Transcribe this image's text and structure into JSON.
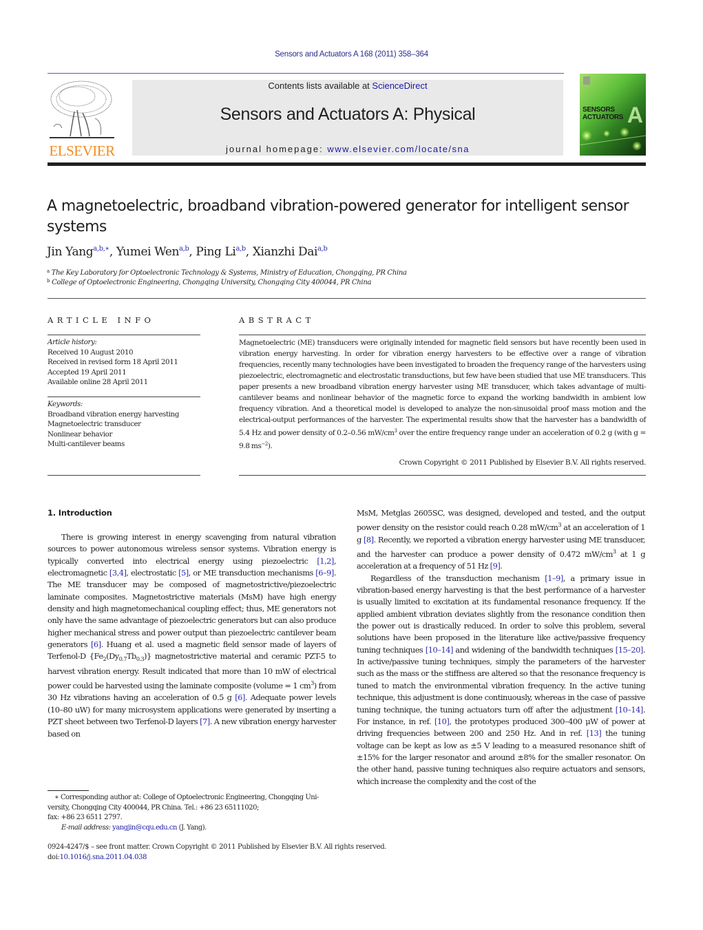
{
  "header": {
    "journal_ref": "Sensors and Actuators A 168 (2011) 358–364",
    "contents_prefix": "Contents lists available at ",
    "contents_link": "ScienceDirect",
    "journal_title": "Sensors and Actuators A: Physical",
    "homepage_prefix": "journal homepage: ",
    "homepage_link": "www.elsevier.com/locate/sna",
    "publisher_logo_text": "ELSEVIER",
    "cover_title_line1": "SENSORS",
    "cover_title_line2": "ACTUATORS",
    "cover_letter": "A",
    "colors": {
      "publisher_orange": "#f28c1e",
      "link_blue": "#1a1aa0",
      "cover_green": "#5cbf3a"
    }
  },
  "article": {
    "title": "A magnetoelectric, broadband vibration-powered generator for intelligent sensor systems",
    "authors": [
      {
        "name": "Jin Yang",
        "affil": "a,b,∗"
      },
      {
        "name": "Yumei Wen",
        "affil": "a,b"
      },
      {
        "name": "Ping Li",
        "affil": "a,b"
      },
      {
        "name": "Xianzhi Dai",
        "affil": "a,b"
      }
    ],
    "affiliations": [
      {
        "mark": "a",
        "text": "The Key Laboratory for Optoelectronic Technology & Systems, Ministry of Education, Chongqing, PR China"
      },
      {
        "mark": "b",
        "text": "College of Optoelectronic Engineering, Chongqing University, Chongqing City 400044, PR China"
      }
    ]
  },
  "article_info": {
    "heading": "ARTICLE INFO",
    "history_label": "Article history:",
    "history": [
      "Received 10 August 2010",
      "Received in revised form 18 April 2011",
      "Accepted 19 April 2011",
      "Available online 28 April 2011"
    ],
    "keywords_label": "Keywords:",
    "keywords": [
      "Broadband vibration energy harvesting",
      "Magnetoelectric transducer",
      "Nonlinear behavior",
      "Multi-cantilever beams"
    ]
  },
  "abstract": {
    "heading": "ABSTRACT",
    "text_part1": "Magnetoelectric (ME) transducers were originally intended for magnetic field sensors but have recently been used in vibration energy harvesting. In order for vibration energy harvesters to be effective over a range of vibration frequencies, recently many technologies have been investigated to broaden the frequency range of the harvesters using piezoelectric, electromagnetic and electrostatic transductions, but few have been studied that use ME transducers. This paper presents a new broadband vibration energy harvester using ME transducer, which takes advantage of multi-cantilever beams and nonlinear behavior of the magnetic force to expand the working bandwidth in ambient low frequency vibration. And a theoretical model is developed to analyze the non-sinusoidal proof mass motion and the electrical-output performances of the harvester. The experimental results show that the harvester has a bandwidth of 5.4 Hz and power density of 0.2–0.56 mW/cm",
    "text_sup1": "3",
    "text_part2": " over the entire frequency range under an acceleration of 0.2 g (with g = 9.8 ms",
    "text_sup2": "−2",
    "text_part3": ").",
    "copyright": "Crown Copyright © 2011 Published by Elsevier B.V. All rights reserved."
  },
  "introduction": {
    "heading": "1.  Introduction",
    "left_column": {
      "p1_a": "There is growing interest in energy scavenging from natural vibration sources to power autonomous wireless sensor systems. Vibration energy is typically converted into electrical energy using piezoelectric ",
      "c1": "[1,2]",
      "p1_b": ", electromagnetic ",
      "c2": "[3,4]",
      "p1_c": ", electrostatic ",
      "c3": "[5]",
      "p1_d": ", or ME transduction mechanisms ",
      "c4": "[6–9]",
      "p1_e": ". The ME transducer may be composed of magnetostrictive/piezoelectric laminate compos­ites. Magnetostrictive materials (MsM) have high energy density and high magnetomechanical coupling effect; thus, ME genera­tors not only have the same advantage of piezoelectric generators but can also produce higher mechanical stress and power out­put than piezoelectric cantilever beam generators ",
      "c5": "[6]",
      "p1_f": ". Huang et al. used a magnetic field sensor made of layers of Terfenol-D {Fe",
      "sub1": "2",
      "p1_g": "(Dy",
      "sub2": "0.7",
      "p1_h": "Tb",
      "sub3": "0.3",
      "p1_i": ")} magnetostrictive material and ceramic PZT-5 to harvest vibration energy. Result indicated that more than 10 mW of electrical power could be harvested using the laminate compos­ite (volume = 1 cm",
      "sup1": "3",
      "p1_j": ") from 30 Hz vibrations having an acceleration of 0.5 g ",
      "c6": "[6]",
      "p1_k": ". Adequate power levels (10–80 uW) for many microsystem applications were generated by inserting a PZT sheet between two Terfenol-D layers ",
      "c7": "[7]",
      "p1_l": ". A new vibration energy harvester based on"
    },
    "right_column": {
      "p1_a": "MsM, Metglas 2605SC, was designed, developed and tested, and the output power density on the resistor could reach 0.28 mW/cm",
      "sup1": "3",
      "p1_b": " at an acceleration of 1 g ",
      "c1": "[8]",
      "p1_c": ". Recently, we reported a vibration energy harvester using ME transducer, and the harvester can produce a power density of 0.472 mW/cm",
      "sup2": "3",
      "p1_d": " at 1 g acceleration at a frequency of 51 Hz ",
      "c2": "[9]",
      "p1_e": ".",
      "p2_a": "Regardless of the transduction mechanism ",
      "c3": "[1–9]",
      "p2_b": ", a primary issue in vibration-based energy harvesting is that the best per­formance of a harvester is usually limited to excitation at its fundamental resonance frequency. If the applied ambient vibra­tion deviates slightly from the resonance condition then the power out is drastically reduced. In order to solve this problem, several solutions have been proposed in the literature like active/passive frequency tuning techniques ",
      "c4": "[10–14]",
      "p2_c": " and widening of the band­width techniques ",
      "c5": "[15–20]",
      "p2_d": ". In active/passive tuning techniques, simply the parameters of the harvester such as the mass or the stiffness are altered so that the resonance frequency is tuned to match the environmental vibration frequency. In the active tuning technique, this adjustment is done continuously, whereas in the case of passive tuning technique, the tuning actuators turn off after the adjustment ",
      "c6": "[10–14]",
      "p2_e": ". For instance, in ref. ",
      "c7": "[10]",
      "p2_f": ", the prototypes produced 300–400 μW of power at driving frequencies between 200 and 250 Hz. And in ref. ",
      "c8": "[13]",
      "p2_g": " the tuning voltage can be kept as low as ±5 V leading to a measured resonance shift of ±15% for the larger resonator and around ±8% for the smaller resonator. On the other hand, passive tuning techniques also require actuators and sensors, which increase the complexity and the cost of the"
    }
  },
  "footnote": {
    "corresponding": "∗ Corresponding author at: College of Optoelectronic Engineering, Chongqing Uni­versity, Chongqing City 400044, PR China. Tel.: +86 23 65111020;",
    "fax": "fax: +86 23 6511 2797.",
    "email_label": "E-mail address: ",
    "email": "yangjin@cqu.edu.cn",
    "email_owner": " (J. Yang)."
  },
  "front_matter": {
    "issn_line": "0924-4247/$ – see front matter. Crown Copyright © 2011 Published by Elsevier B.V. All rights reserved.",
    "doi_prefix": "doi:",
    "doi": "10.1016/j.sna.2011.04.038"
  }
}
